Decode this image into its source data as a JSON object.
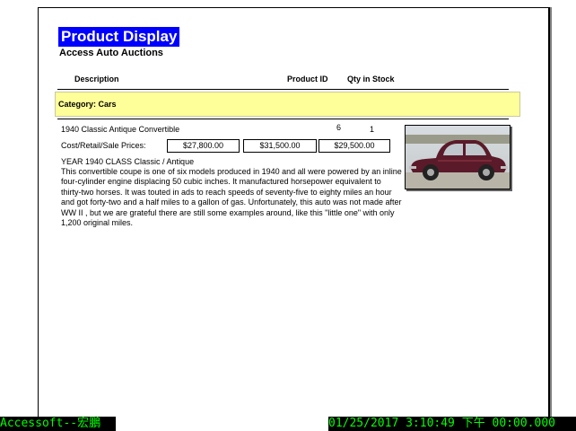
{
  "report": {
    "title": "Product Display",
    "subtitle": "Access Auto Auctions",
    "columns": {
      "description": "Description",
      "product_id": "Product ID",
      "qty": "Qty in Stock"
    },
    "category_label": "Category: Cars",
    "product": {
      "name": "1940 Classic Antique Convertible",
      "id": "6",
      "qty": "1",
      "prices_label": "Cost/Retail/Sale Prices:",
      "cost": "$27,800.00",
      "retail": "$31,500.00",
      "sale": "$29,500.00",
      "year_class": "YEAR 1940   CLASS Classic / Antique",
      "description": "This convertible coupe is one of six models produced in 1940 and all were powered by an inline four-cylinder engine displacing 50 cubic inches. It manufactured horsepower equivalent to thirty-two horses. It was touted in ads to reach speeds of seventy-five to eighty miles an hour and got forty-two and a half miles to a gallon of gas. Unfortunately, this auto was not made after WW II , but we are grateful there are still some examples around, like this \"little one\" with only 1,200 original miles.",
      "image_icon": "car-photo-maroon-sedan"
    }
  },
  "status": {
    "left": "Accessoft--宏鵬",
    "right": "01/25/2017 3:10:49 下午 00:00.000"
  },
  "colors": {
    "title_bg": "#0000ff",
    "category_bg": "#ffff99",
    "status_fg": "#00ff00"
  }
}
